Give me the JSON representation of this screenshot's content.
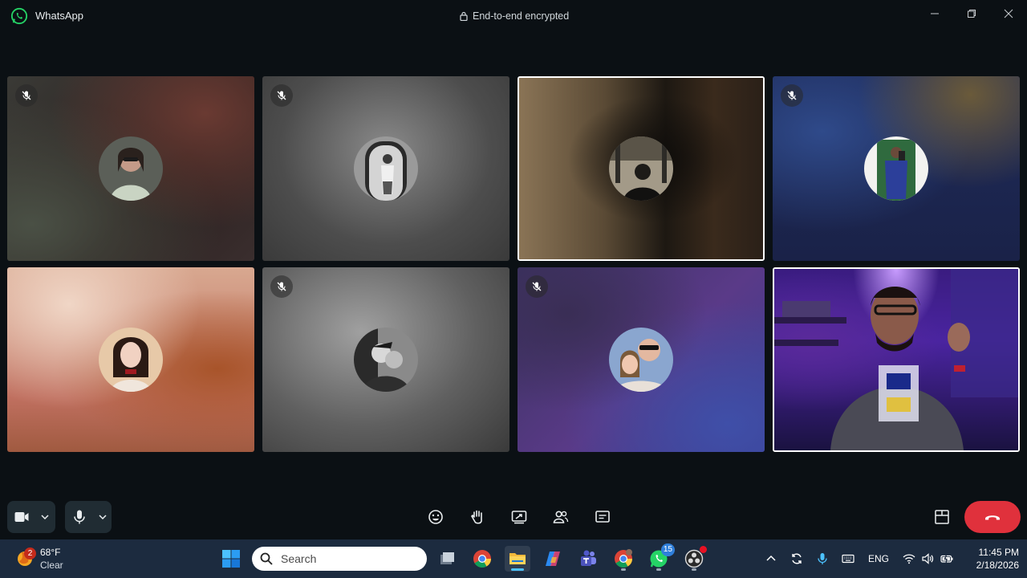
{
  "window": {
    "app_name": "WhatsApp",
    "encryption_label": "End-to-end encrypted",
    "controls": [
      "minimize-icon",
      "restore-icon",
      "close-icon"
    ]
  },
  "participants": [
    {
      "position": "row1-col1",
      "muted": true,
      "speaking": false,
      "avatar": "woman-selfie-photo",
      "bg": "dark-brown-red-blur"
    },
    {
      "position": "row1-col2",
      "muted": true,
      "speaking": false,
      "avatar": "mirror-photo-grayscale",
      "bg": "gray-blur"
    },
    {
      "position": "row1-col3",
      "muted": false,
      "speaking": true,
      "avatar": "man-back-view-photo",
      "bg": "gold-black-blur"
    },
    {
      "position": "row1-col4",
      "muted": true,
      "speaking": false,
      "avatar": "man-mirror-selfie-blue",
      "bg": "blue-navy-blur"
    },
    {
      "position": "row2-col1",
      "muted": false,
      "speaking": false,
      "avatar": "woman-portrait-photo",
      "bg": "peach-orange-blur"
    },
    {
      "position": "row2-col2",
      "muted": true,
      "speaking": false,
      "avatar": "couple-grayscale-photo",
      "bg": "gray-blur"
    },
    {
      "position": "row2-col3",
      "muted": true,
      "speaking": false,
      "avatar": "couple-sunglasses-photo",
      "bg": "purple-blur"
    },
    {
      "position": "row2-col4",
      "muted": false,
      "speaking": true,
      "avatar": "self-video-feed",
      "bg": "purple-neon-room",
      "is_video": true
    }
  ],
  "call_controls": {
    "left": [
      "video-camera-icon",
      "chevron-down-icon",
      "microphone-icon",
      "chevron-down-icon"
    ],
    "center": [
      "emoji-icon",
      "raise-hand-icon",
      "screen-share-icon",
      "participants-icon",
      "chat-icon"
    ],
    "right": [
      "layout-icon",
      "end-call-icon"
    ],
    "end_call_color": "#e0313c"
  },
  "taskbar": {
    "weather": {
      "badge": "2",
      "temp": "68°F",
      "condition": "Clear"
    },
    "search_placeholder": "Search",
    "apps": [
      {
        "name": "task-view-icon",
        "active": false,
        "running": false
      },
      {
        "name": "chrome-icon",
        "active": false,
        "running": false
      },
      {
        "name": "file-explorer-icon",
        "active": true,
        "running": true
      },
      {
        "name": "copilot-icon",
        "active": false,
        "running": false
      },
      {
        "name": "teams-icon",
        "active": false,
        "running": false
      },
      {
        "name": "chrome-profile-icon",
        "active": false,
        "running": true
      },
      {
        "name": "whatsapp-icon",
        "active": false,
        "running": true,
        "badge": "15"
      },
      {
        "name": "obs-icon",
        "active": false,
        "running": true,
        "dot": true
      }
    ],
    "tray": {
      "language": "ENG",
      "time": "11:45 PM",
      "date": "2/18/2026"
    }
  }
}
